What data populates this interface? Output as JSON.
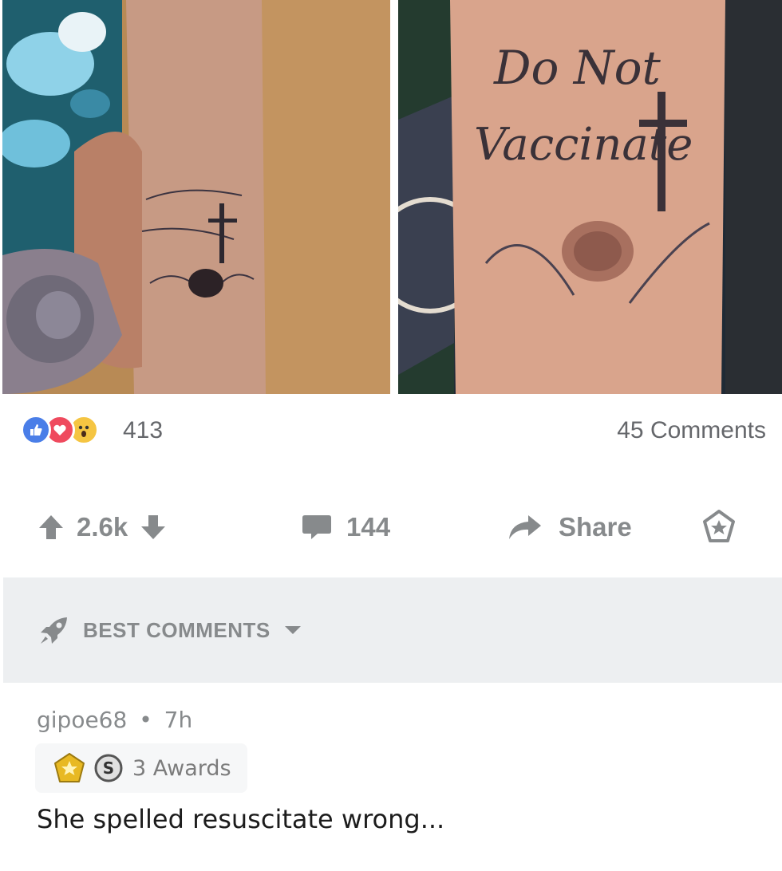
{
  "facebook": {
    "reaction_icons": [
      "like-icon",
      "love-icon",
      "wow-icon"
    ],
    "reaction_count": "413",
    "comments": "45 Comments"
  },
  "post_actions": {
    "score": "2.6k",
    "comment_count": "144",
    "share_label": "Share"
  },
  "comments_sort": {
    "label": "BEST COMMENTS"
  },
  "comment": {
    "author": "gipoe68",
    "separator": "•",
    "age": "7h",
    "awards_label": "3 Awards",
    "body": "She spelled resuscitate wrong..."
  },
  "colors": {
    "meta_gray": "#878a8c",
    "sort_bar_bg": "#edeff1",
    "fb_like": "#4a7ee8",
    "fb_love": "#ef4a5e",
    "fb_wow": "#f5c542"
  }
}
